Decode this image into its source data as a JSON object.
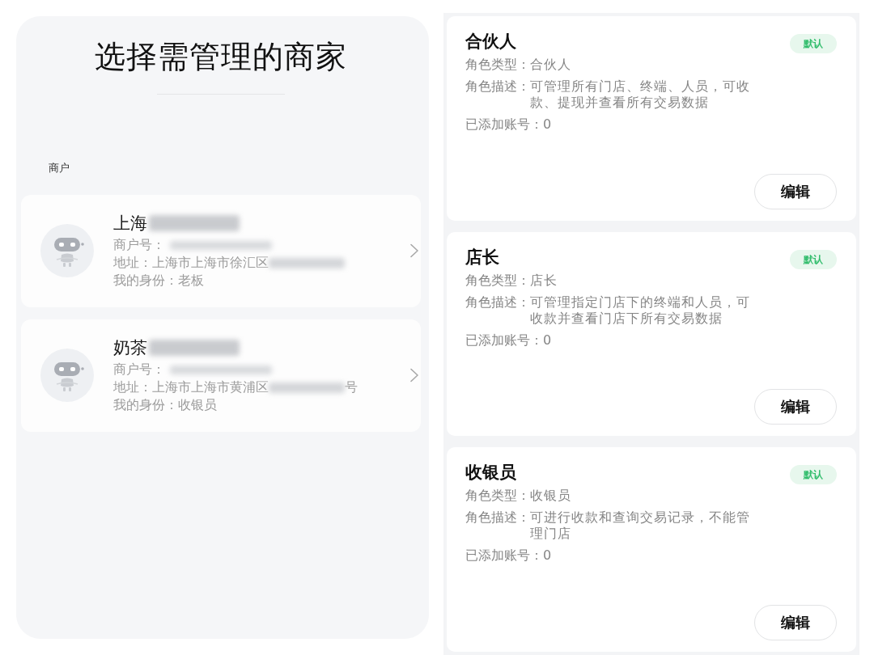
{
  "left_panel": {
    "title": "选择需管理的商家",
    "section_label": "商户",
    "merchants": [
      {
        "name": "上海",
        "name_redacted": true,
        "fields": [
          {
            "label": "商户号：",
            "redacted": true
          },
          {
            "label": "地址：",
            "value": "上海市上海市徐汇区",
            "redacted": true
          },
          {
            "label": "我的身份：",
            "value": "老板"
          }
        ]
      },
      {
        "name": "奶茶",
        "name_redacted": true,
        "fields": [
          {
            "label": "商户号：",
            "redacted": true
          },
          {
            "label": "地址：",
            "value": "上海市上海市黄浦区",
            "redacted": true,
            "suffix": "号"
          },
          {
            "label": "我的身份：",
            "value": "收银员"
          }
        ]
      }
    ]
  },
  "roles": [
    {
      "title": "合伙人",
      "badge": "默认",
      "fields": [
        {
          "label": "角色类型：",
          "value": "合伙人"
        },
        {
          "label": "角色描述：",
          "value": "可管理所有门店、终端、人员，可收款、提现并查看所有交易数据"
        },
        {
          "label": "已添加账号：",
          "value": "0"
        }
      ],
      "button": "编辑"
    },
    {
      "title": "店长",
      "badge": "默认",
      "fields": [
        {
          "label": "角色类型：",
          "value": "店长"
        },
        {
          "label": "角色描述：",
          "value": "可管理指定门店下的终端和人员，可收款并查看门店下所有交易数据"
        },
        {
          "label": "已添加账号：",
          "value": "0"
        }
      ],
      "button": "编辑"
    },
    {
      "title": "收银员",
      "badge": "默认",
      "fields": [
        {
          "label": "角色类型：",
          "value": "收银员"
        },
        {
          "label": "角色描述：",
          "value": "可进行收款和查询交易记录，不能管理门店"
        },
        {
          "label": "已添加账号：",
          "value": "0"
        }
      ],
      "button": "编辑"
    }
  ]
}
